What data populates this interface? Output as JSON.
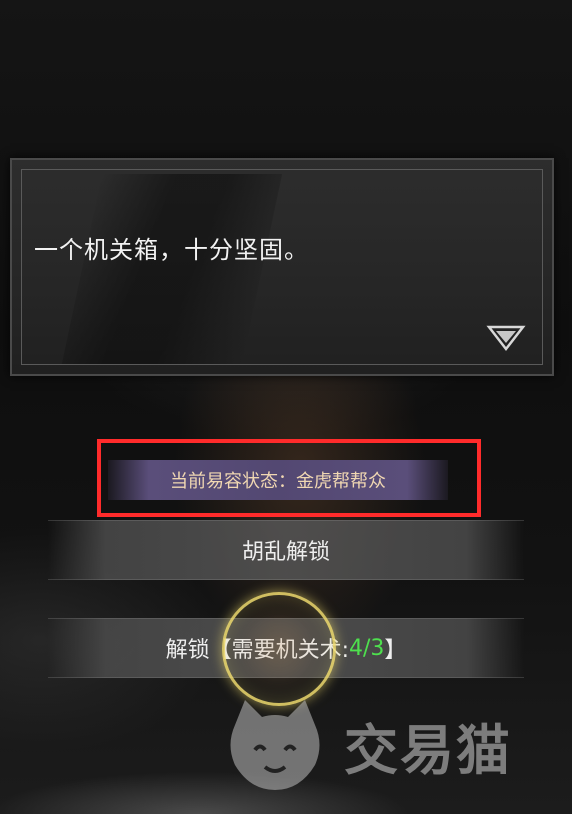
{
  "dialog": {
    "text": "一个机关箱，十分坚固。",
    "next_icon": "down-triangle-icon"
  },
  "disguise_status": {
    "label": "当前易容状态：金虎帮帮众"
  },
  "options": [
    {
      "label": "胡乱解锁"
    },
    {
      "label_prefix": "解锁【需要机关术:",
      "requirement": "4/3",
      "label_suffix": "】"
    }
  ],
  "highlight_color": "#ff2b2b",
  "requirement_color": "#4ee04e",
  "watermark": {
    "text": "交易猫",
    "icon": "cat-face-logo-icon"
  }
}
